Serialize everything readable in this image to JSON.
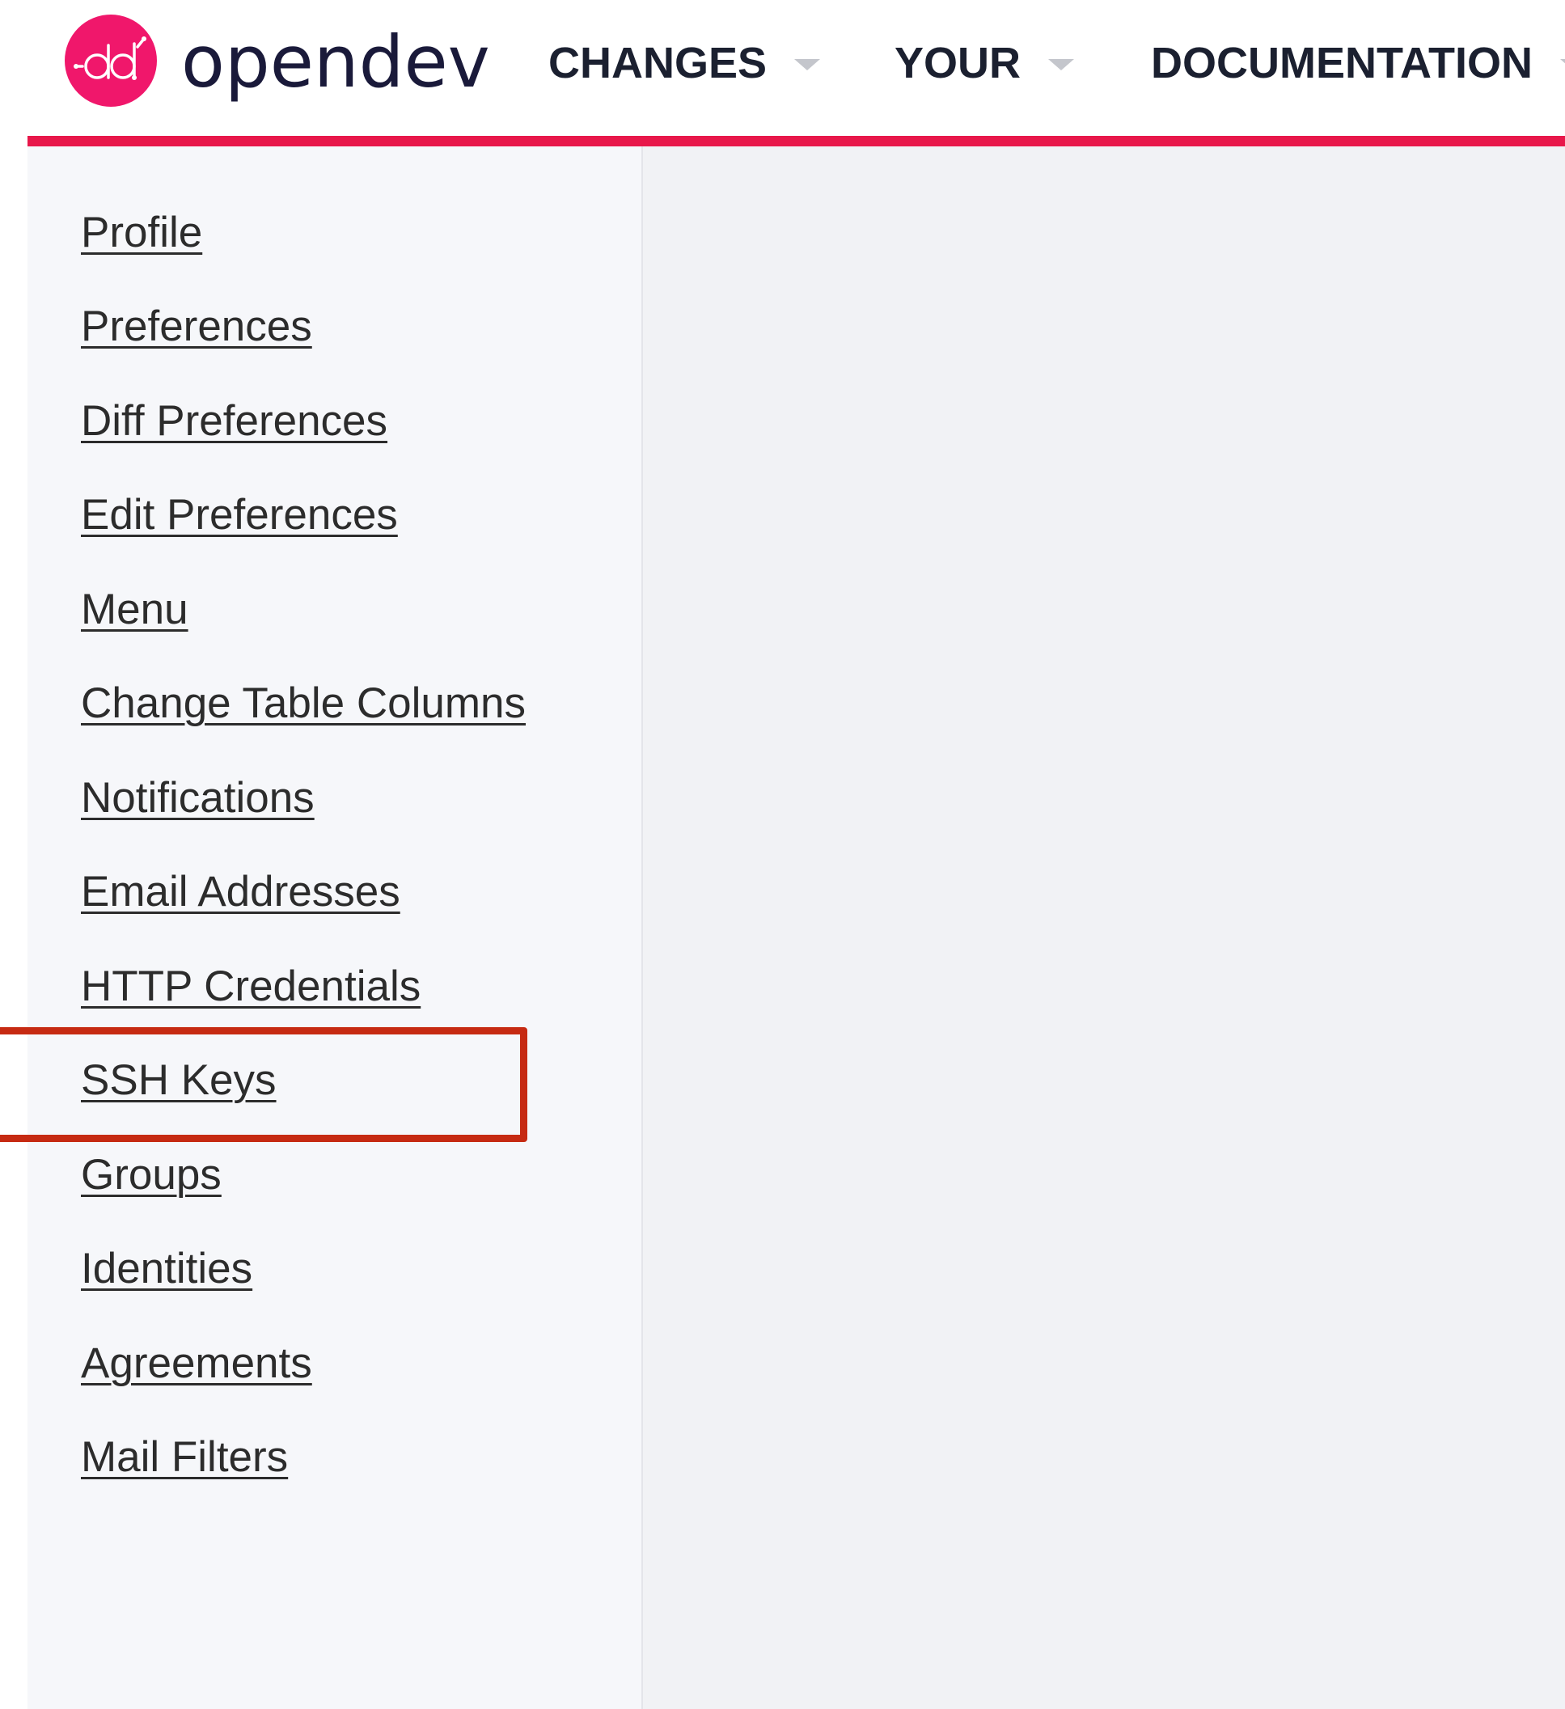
{
  "header": {
    "brand": "opendev",
    "nav": [
      {
        "label": "CHANGES"
      },
      {
        "label": "YOUR"
      },
      {
        "label": "DOCUMENTATION"
      }
    ],
    "accent_color": "#e8174a",
    "logo_icon": "opendev-logo-icon"
  },
  "sidebar": {
    "items": [
      {
        "label": "Profile"
      },
      {
        "label": "Preferences"
      },
      {
        "label": "Diff Preferences"
      },
      {
        "label": "Edit Preferences"
      },
      {
        "label": "Menu"
      },
      {
        "label": "Change Table Columns"
      },
      {
        "label": "Notifications"
      },
      {
        "label": "Email Addresses"
      },
      {
        "label": "HTTP Credentials"
      },
      {
        "label": "SSH Keys"
      },
      {
        "label": "Groups"
      },
      {
        "label": "Identities"
      },
      {
        "label": "Agreements"
      },
      {
        "label": "Mail Filters"
      }
    ],
    "highlighted_item": "SSH Keys",
    "highlight_color": "#c62a12"
  }
}
